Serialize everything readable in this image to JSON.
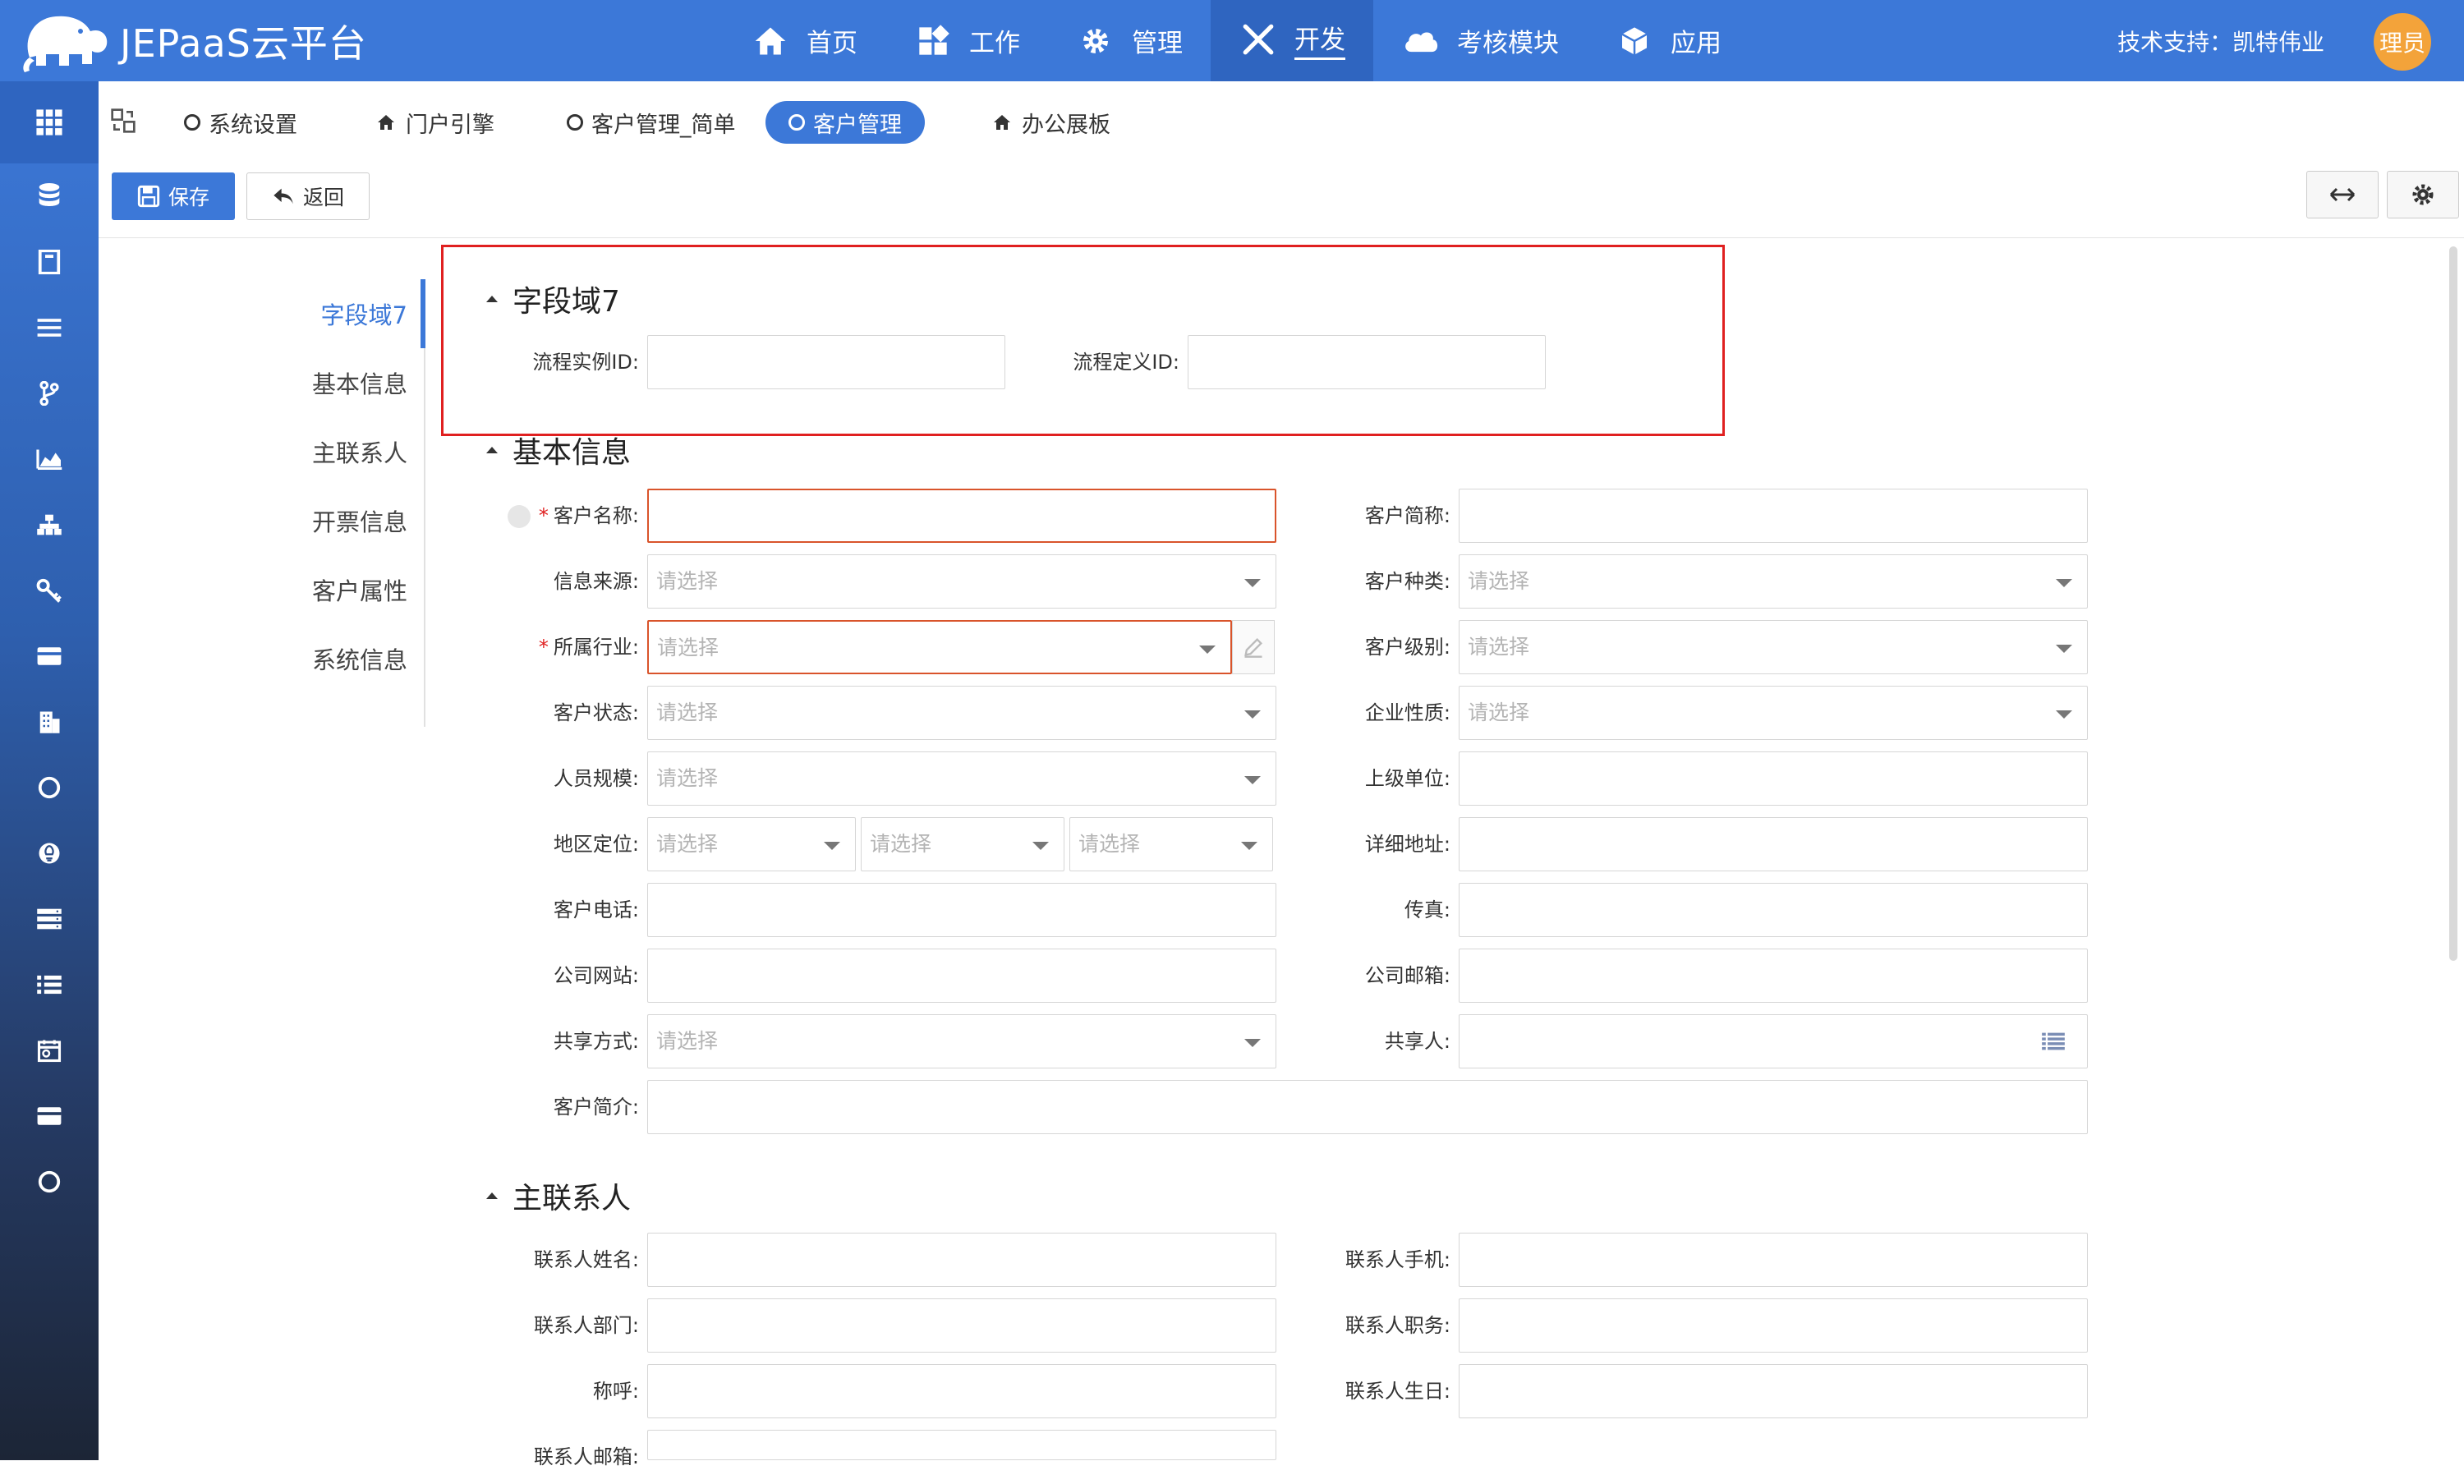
{
  "app": {
    "title": "JEPaaS云平台"
  },
  "topnav": [
    {
      "label": "首页",
      "icon": "home-icon"
    },
    {
      "label": "工作",
      "icon": "dashboard-icon"
    },
    {
      "label": "管理",
      "icon": "gear-icon"
    },
    {
      "label": "开发",
      "icon": "tools-icon",
      "active": true
    },
    {
      "label": "考核模块",
      "icon": "cloud-icon"
    },
    {
      "label": "应用",
      "icon": "cube-icon"
    }
  ],
  "header": {
    "support": "技术支持：凯特伟业",
    "avatar_text": "理员"
  },
  "tabs": [
    {
      "label": "系统设置",
      "icon": "circle-icon"
    },
    {
      "label": "门户引擎",
      "icon": "home-icon"
    },
    {
      "label": "客户管理_简单",
      "icon": "circle-icon"
    },
    {
      "label": "客户管理",
      "icon": "circle-icon",
      "active": true
    },
    {
      "label": "办公展板",
      "icon": "home-icon"
    }
  ],
  "toolbar": {
    "save_label": "保存",
    "back_label": "返回"
  },
  "leftnav": [
    "字段域7",
    "基本信息",
    "主联系人",
    "开票信息",
    "客户属性",
    "系统信息"
  ],
  "sections": {
    "field7": {
      "title": "字段域7",
      "flow_instance_id": "流程实例ID:",
      "flow_definition_id": "流程定义ID:"
    },
    "basic": {
      "title": "基本信息",
      "placeholder": "请选择",
      "customer_name": "客户名称:",
      "customer_short": "客户简称:",
      "info_source": "信息来源:",
      "customer_type": "客户种类:",
      "industry": "所属行业:",
      "customer_level": "客户级别:",
      "customer_status": "客户状态:",
      "enterprise_nature": "企业性质:",
      "staff_size": "人员规模:",
      "parent_unit": "上级单位:",
      "region": "地区定位:",
      "address": "详细地址:",
      "phone": "客户电话:",
      "fax": "传真:",
      "website": "公司网站:",
      "email": "公司邮箱:",
      "share_mode": "共享方式:",
      "sharer": "共享人:",
      "intro": "客户简介:"
    },
    "contact": {
      "title": "主联系人",
      "name": "联系人姓名:",
      "mobile": "联系人手机:",
      "dept": "联系人部门:",
      "position": "联系人职务:",
      "salutation": "称呼:",
      "birthday": "联系人生日:",
      "email": "联系人邮箱:"
    }
  },
  "colors": {
    "primary": "#3c78d8",
    "error": "#d9542b",
    "highlight": "#e02020"
  }
}
